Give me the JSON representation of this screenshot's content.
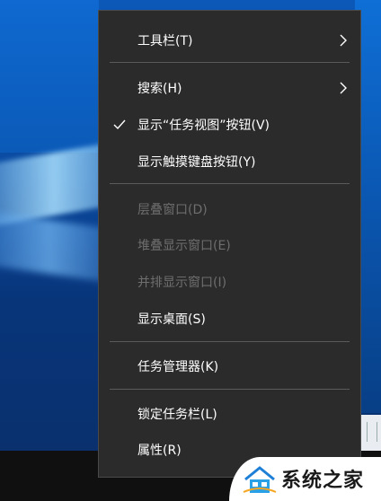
{
  "menu": {
    "items": [
      {
        "label": "工具栏(T)",
        "submenu": true,
        "checked": false,
        "disabled": false
      },
      {
        "label": "搜索(H)",
        "submenu": true,
        "checked": false,
        "disabled": false
      },
      {
        "label": "显示“任务视图”按钮(V)",
        "submenu": false,
        "checked": true,
        "disabled": false
      },
      {
        "label": "显示触摸键盘按钮(Y)",
        "submenu": false,
        "checked": false,
        "disabled": false
      },
      {
        "label": "层叠窗口(D)",
        "submenu": false,
        "checked": false,
        "disabled": true
      },
      {
        "label": "堆叠显示窗口(E)",
        "submenu": false,
        "checked": false,
        "disabled": true
      },
      {
        "label": "并排显示窗口(I)",
        "submenu": false,
        "checked": false,
        "disabled": true
      },
      {
        "label": "显示桌面(S)",
        "submenu": false,
        "checked": false,
        "disabled": false
      },
      {
        "label": "任务管理器(K)",
        "submenu": false,
        "checked": false,
        "disabled": false
      },
      {
        "label": "锁定任务栏(L)",
        "submenu": false,
        "checked": false,
        "disabled": false
      },
      {
        "label": "属性(R)",
        "submenu": false,
        "checked": false,
        "disabled": false
      }
    ],
    "check_glyph": "✓",
    "arrow_glyph": "›"
  },
  "watermark": {
    "text": "系统之家"
  },
  "colors": {
    "menu_bg": "#2b2b2b",
    "menu_text": "#ffffff",
    "menu_disabled_text": "#6e6e6e",
    "separator": "#5a5a5a",
    "taskbar": "#101010"
  }
}
